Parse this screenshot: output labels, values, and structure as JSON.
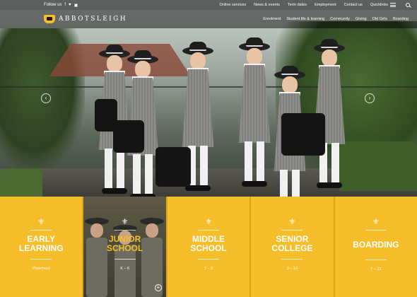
{
  "header": {
    "follow_label": "Follow us",
    "social": [
      {
        "icon": "facebook-icon",
        "glyph": "f"
      },
      {
        "icon": "twitter-icon",
        "glyph": "♥"
      },
      {
        "icon": "instagram-icon",
        "glyph": "▣"
      }
    ],
    "utility_links": [
      "Online services",
      "News & events",
      "Term dates",
      "Employment",
      "Contact us"
    ],
    "quicklinks_label": "Quicklinks",
    "brand": "ABBOTSLEIGH",
    "main_nav": [
      "Enrolment",
      "Student life & learning",
      "Community",
      "Giving",
      "Old Girls",
      "Boarding"
    ]
  },
  "hero": {
    "prev_glyph": "‹",
    "next_glyph": "›"
  },
  "tiles": [
    {
      "title_l1": "EARLY",
      "title_l2": "LEARNING",
      "sub": "Preschool",
      "fleur": "⚜"
    },
    {
      "title_l1": "JUNIOR",
      "title_l2": "SCHOOL",
      "sub": "K – 6",
      "fleur": "⚜",
      "plus": "+"
    },
    {
      "title_l1": "MIDDLE",
      "title_l2": "SCHOOL",
      "sub": "7 – 8",
      "fleur": "⚜"
    },
    {
      "title_l1": "SENIOR",
      "title_l2": "COLLEGE",
      "sub": "9 – 12",
      "fleur": "⚜"
    },
    {
      "title_l1": "BOARDING",
      "title_l2": "",
      "sub": "7 – 12",
      "fleur": "⚜"
    }
  ],
  "colors": {
    "accent": "#f7be2c",
    "bar": "#000000"
  }
}
